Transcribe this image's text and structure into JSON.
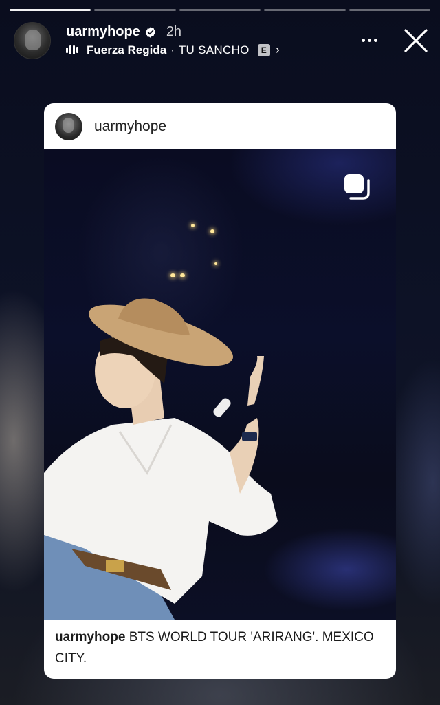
{
  "progress": {
    "segments": 5,
    "active_index": 0
  },
  "story_header": {
    "username": "uarmyhope",
    "verified_icon": "verified-badge-icon",
    "time": "2h",
    "music": {
      "icon": "audio-bars-icon",
      "artist": "Fuerza Regida",
      "separator": "·",
      "song": "TU SANCHO",
      "explicit_badge": "E",
      "chevron": "›"
    }
  },
  "controls": {
    "more_icon": "more-dots-icon",
    "close_icon": "close-icon"
  },
  "post": {
    "username": "uarmyhope",
    "media_icon": "multiple-photos-icon",
    "caption_user": "uarmyhope",
    "caption_text": "BTS WORLD TOUR 'ARIRANG'. MEXICO CITY."
  },
  "colors": {
    "background": "#0b0e1a",
    "card": "#ffffff",
    "text_light": "#ffffff",
    "text_dark": "#1b1b1b"
  }
}
